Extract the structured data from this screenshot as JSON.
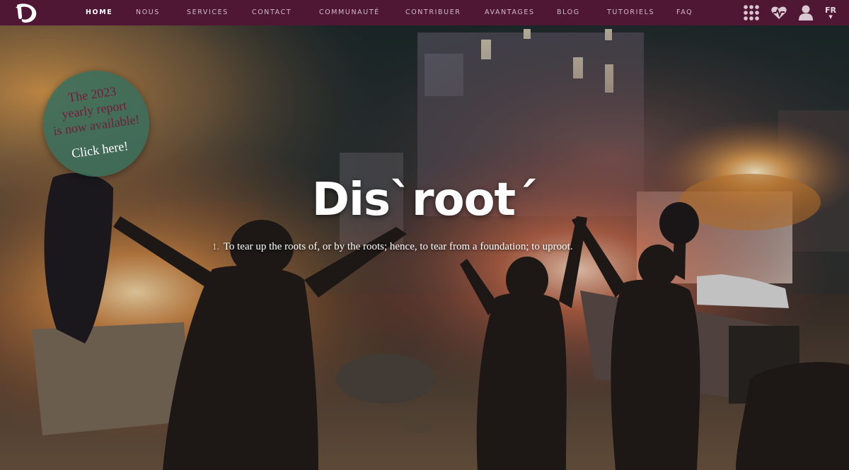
{
  "nav": {
    "links": [
      {
        "label": "HOME",
        "active": true
      },
      {
        "label": "NOUS",
        "active": false
      },
      {
        "label": "SERVICES",
        "active": false
      },
      {
        "label": "CONTACT",
        "active": false
      },
      {
        "label": "COMMUNAUTÉ",
        "active": false
      },
      {
        "label": "CONTRIBUER",
        "active": false
      },
      {
        "label": "AVANTAGES",
        "active": false
      },
      {
        "label": "BLOG",
        "active": false
      },
      {
        "label": "TUTORIELS",
        "active": false
      },
      {
        "label": "FAQ",
        "active": false
      }
    ],
    "icons": [
      "apps-grid-icon",
      "heart-pulse-icon",
      "user-icon"
    ],
    "language": "FR"
  },
  "hero": {
    "title": "Dis`root´",
    "definition_number": "1.",
    "definition": "To tear up the roots of, or by the roots; hence, to tear from a foundation; to uproot."
  },
  "badge": {
    "line1": "The 2023",
    "line2": "yearly report",
    "line3": "is now available!",
    "cta": "Click here!"
  },
  "colors": {
    "navbar": "#4f1734",
    "badge": "#3a6e5c",
    "badge_text": "#6e1f3c"
  }
}
